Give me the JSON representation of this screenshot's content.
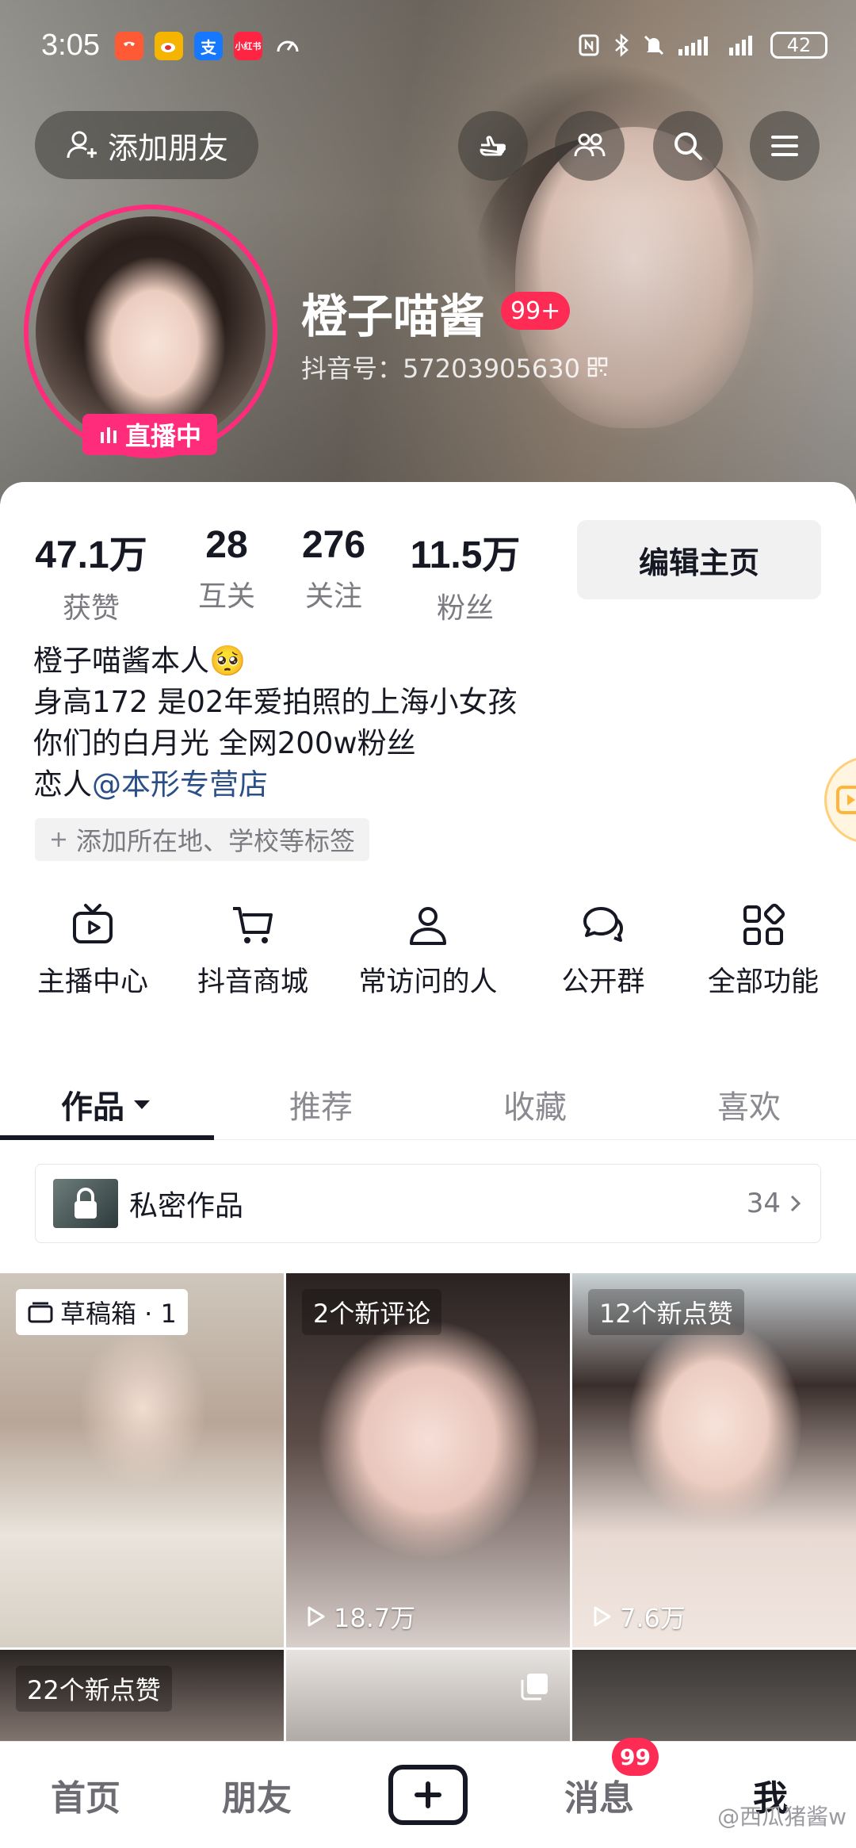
{
  "status_bar": {
    "time": "3:05",
    "apps": [
      {
        "icon": "phone-icon",
        "color": "#ff5a36"
      },
      {
        "icon": "weibo-icon",
        "color": "#f5b400"
      },
      {
        "icon": "alipay-icon",
        "glyph": "支",
        "color": "#1677ff"
      },
      {
        "icon": "xiaohongshu-icon",
        "glyph": "小红书",
        "color": "#ff2442"
      },
      {
        "icon": "speed-icon",
        "color": "transparent"
      }
    ],
    "battery": "42"
  },
  "header": {
    "add_friend_label": "添加朋友",
    "nickname": "橙子喵酱",
    "nickname_badge": "99+",
    "douyin_id": "抖音号：57203905630",
    "live_label": "直播中"
  },
  "stats": [
    {
      "value": "47.1万",
      "label": "获赞"
    },
    {
      "value": "28",
      "label": "互关"
    },
    {
      "value": "276",
      "label": "关注"
    },
    {
      "value": "11.5万",
      "label": "粉丝"
    }
  ],
  "edit_profile_label": "编辑主页",
  "bio": {
    "line1": "橙子喵酱本人🥺",
    "line2": "身高172 是02年爱拍照的上海小女孩",
    "line3": "你们的白月光 全网200w粉丝",
    "line4_prefix": "恋人",
    "line4_mention": "@本形专营店"
  },
  "tag_chip_label": "添加所在地、学校等标签",
  "functions": [
    {
      "label": "主播中心",
      "icon": "tv-icon"
    },
    {
      "label": "抖音商城",
      "icon": "cart-icon"
    },
    {
      "label": "常访问的人",
      "icon": "person-icon"
    },
    {
      "label": "公开群",
      "icon": "group-chat-icon"
    },
    {
      "label": "全部功能",
      "icon": "grid-icon"
    }
  ],
  "tabs": [
    "作品",
    "推荐",
    "收藏",
    "喜欢"
  ],
  "active_tab": "作品",
  "private_works": {
    "label": "私密作品",
    "count": "34"
  },
  "grid": [
    {
      "tag": "草稿箱 · 1",
      "plays": ""
    },
    {
      "tag": "2个新评论",
      "plays": "18.7万"
    },
    {
      "tag": "12个新点赞",
      "plays": "7.6万"
    },
    {
      "tag": "22个新点赞",
      "plays": ""
    },
    {
      "tag": "",
      "plays": ""
    },
    {
      "tag": "",
      "plays": ""
    }
  ],
  "bottom_nav": {
    "home": "首页",
    "friends": "朋友",
    "messages": "消息",
    "messages_badge": "99",
    "me": "我"
  },
  "watermark": "@西瓜猪酱w",
  "colors": {
    "accent": "#fe2c55",
    "live_pink": "#ff2b7b",
    "mention": "#2a4f86"
  }
}
